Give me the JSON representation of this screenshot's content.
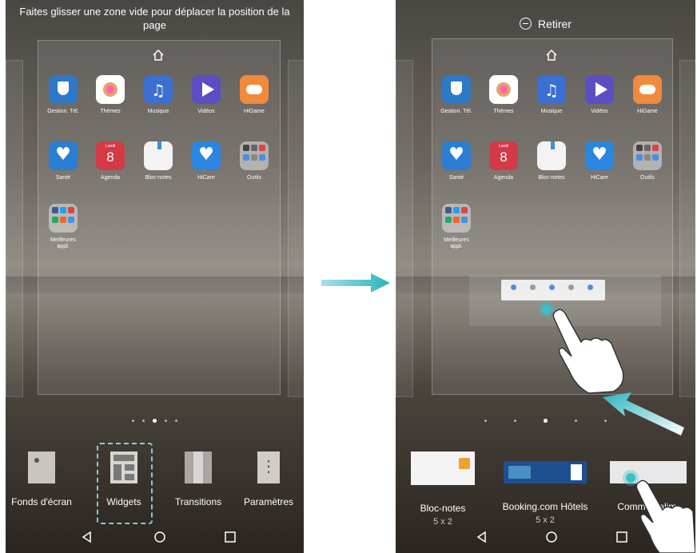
{
  "left_screen": {
    "hint": "Faites glisser une zone vide pour déplacer la position de la page",
    "apps_row1": [
      "Gestion. Tél.",
      "Thèmes",
      "Musique",
      "Vidéos",
      "HiGame"
    ],
    "apps_row2": [
      "Santé",
      "Agenda",
      "Bloc-notes",
      "HiCare",
      "Outils"
    ],
    "apps_row3": [
      "Meilleures appl."
    ],
    "agenda_day": "Lundi",
    "agenda_date": "8",
    "tools": [
      "Fonds d'écran",
      "Widgets",
      "Transitions",
      "Paramètres"
    ]
  },
  "right_screen": {
    "remove_label": "Retirer",
    "apps_row1": [
      "Gestion. Tél.",
      "Thèmes",
      "Musique",
      "Vidéos",
      "HiGame"
    ],
    "apps_row2": [
      "Santé",
      "Agenda",
      "Bloc-notes",
      "HiCare",
      "Outils"
    ],
    "apps_row3": [
      "Meilleures appl."
    ],
    "agenda_day": "Lundi",
    "agenda_date": "8",
    "widgets": [
      {
        "name": "Bloc-notes",
        "size": "5 x 2"
      },
      {
        "name": "Booking.com Hôtels",
        "size": "5 x 2"
      },
      {
        "name": "Commut. alim.",
        "size": ""
      }
    ]
  },
  "colors": {
    "accent": "#3cc0c6",
    "arrow": "#2bb3c0"
  }
}
